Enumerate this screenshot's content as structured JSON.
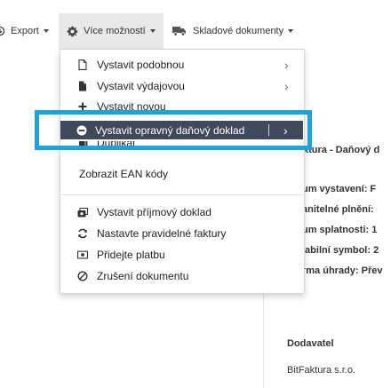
{
  "toolbar": {
    "export_label": "Export",
    "more_label": "Více možností",
    "stock_label": "Skladové dokumenty"
  },
  "menu": {
    "items": [
      {
        "label": "Vystavit podobnou",
        "icon": "document-icon",
        "submenu": true
      },
      {
        "label": "Vystavit výdajovou",
        "icon": "document-filled-icon",
        "submenu": true
      },
      {
        "label": "Vystavit novou",
        "icon": "plus-icon",
        "submenu": false
      },
      {
        "label": "Vystavit opravný daňový doklad",
        "icon": "minus-circle-icon",
        "submenu": true,
        "highlighted": true
      },
      {
        "label": "Duplikát",
        "icon": "copy-icon",
        "submenu": false
      },
      {
        "label": "Zobrazit EAN kódy",
        "icon": "",
        "submenu": false
      },
      {
        "label": "Vystavit příjmový doklad",
        "icon": "cash-in-icon",
        "submenu": false
      },
      {
        "label": "Nastavte pravidelné faktury",
        "icon": "refresh-icon",
        "submenu": false
      },
      {
        "label": "Přidejte platbu",
        "icon": "money-icon",
        "submenu": false
      },
      {
        "label": "Zrušení dokumentu",
        "icon": "ban-icon",
        "submenu": false
      }
    ]
  },
  "document": {
    "heading": "ktura - Daňový d",
    "fields": [
      "um vystavení: F",
      "anitelné plnění: ",
      "um splatnosti: 1",
      "iabilní symbol: 2",
      "rma úhrady: Přev"
    ],
    "supplier_label": "Dodavatel",
    "supplier_name": "BitFaktura s.r.o."
  },
  "colors": {
    "highlight_frame": "#1aa3dc",
    "highlight_bar": "#3e4a5c",
    "toolbar_active_bg": "#e9e9e9"
  }
}
